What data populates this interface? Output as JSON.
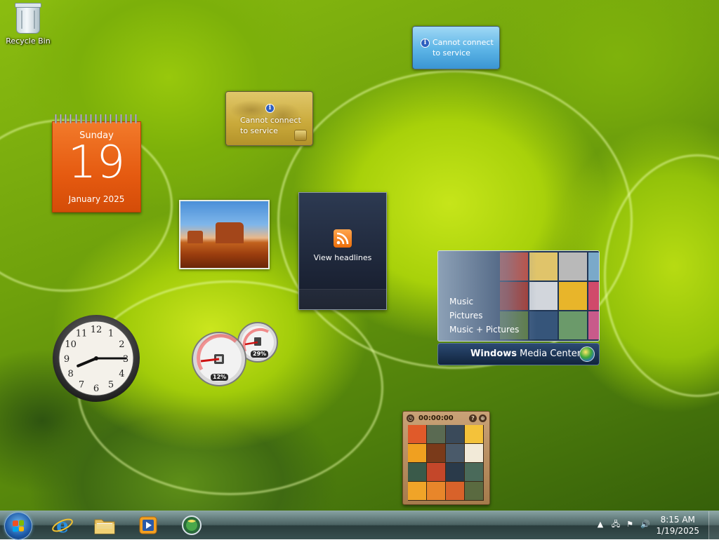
{
  "desktop": {
    "icons": [
      {
        "label": "Recycle Bin",
        "icon": "recycle-bin-icon"
      }
    ]
  },
  "gadgets": {
    "weather": {
      "line1": "Cannot connect",
      "line2": "to service",
      "icon": "info-icon"
    },
    "currency": {
      "line1": "Cannot connect",
      "line2": "to service",
      "icon": "info-icon"
    },
    "calendar": {
      "day_of_week": "Sunday",
      "day": "19",
      "month_year": "January 2025",
      "color": "#e55a10"
    },
    "feed": {
      "label": "View headlines",
      "icon": "rss-icon"
    },
    "media_center": {
      "menu": [
        "Music",
        "Pictures",
        "Music + Pictures"
      ],
      "brand_part1": "Windows",
      "brand_part2": " Media Center"
    },
    "clock": {
      "numerals": [
        "12",
        "1",
        "2",
        "3",
        "4",
        "5",
        "6",
        "7",
        "8",
        "9",
        "10",
        "11"
      ],
      "time": "8:15"
    },
    "cpu_meter": {
      "cpu_percent": "12%",
      "memory_percent": "29%",
      "cpu_value": 12,
      "memory_value": 29
    },
    "puzzle": {
      "timer": "00:00:00"
    }
  },
  "taskbar": {
    "pinned": [
      {
        "name": "internet-explorer",
        "icon": "internet-explorer-icon"
      },
      {
        "name": "windows-explorer",
        "icon": "folder-icon"
      },
      {
        "name": "media-player",
        "icon": "media-player-icon"
      },
      {
        "name": "media-center",
        "icon": "media-center-icon"
      }
    ],
    "tray": {
      "icons": [
        "show-hidden-icons-icon",
        "network-icon",
        "action-center-flag-icon",
        "volume-icon"
      ],
      "time": "8:15 AM",
      "date": "1/19/2025"
    }
  }
}
